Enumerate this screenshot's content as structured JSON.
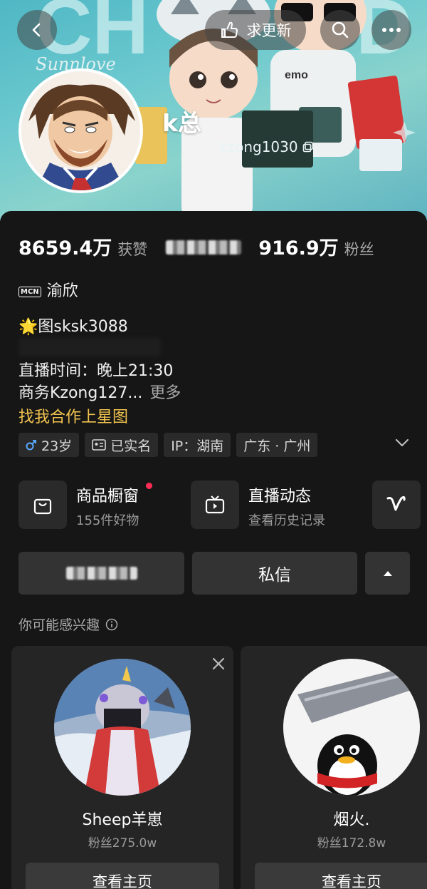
{
  "header": {
    "update_label": "求更新",
    "username": "k总",
    "user_id": "kzong1030"
  },
  "stats": {
    "likes_value": "8659.4万",
    "likes_label": "获赞",
    "fans_value": "916.9万",
    "fans_label": "粉丝"
  },
  "bio": {
    "mcn_badge": "MCN",
    "mcn_name": "渝欣",
    "line1": "🌟图sksk3088",
    "live_time": "直播时间：晚上21:30",
    "business": "商务Kzong127...",
    "more": "更多",
    "star_link": "找我合作上星图"
  },
  "tags": {
    "age": "23岁",
    "verified": "已实名",
    "ip": "IP：湖南",
    "location": "广东 · 广州"
  },
  "features": {
    "shop_title": "商品橱窗",
    "shop_sub": "155件好物",
    "live_title": "直播动态",
    "live_sub": "查看历史记录"
  },
  "actions": {
    "message_label": "私信"
  },
  "recommend": {
    "label": "你可能感兴趣",
    "cards": [
      {
        "name": "Sheep羊崽",
        "fans": "粉丝275.0w",
        "button": "查看主页"
      },
      {
        "name": "烟火.",
        "fans": "粉丝172.8w",
        "button": "查看主页"
      }
    ]
  },
  "colors": {
    "accent_gold": "#f0c34f",
    "notification_red": "#ff2d55",
    "male_blue": "#5aa9ff",
    "background": "#161616"
  }
}
